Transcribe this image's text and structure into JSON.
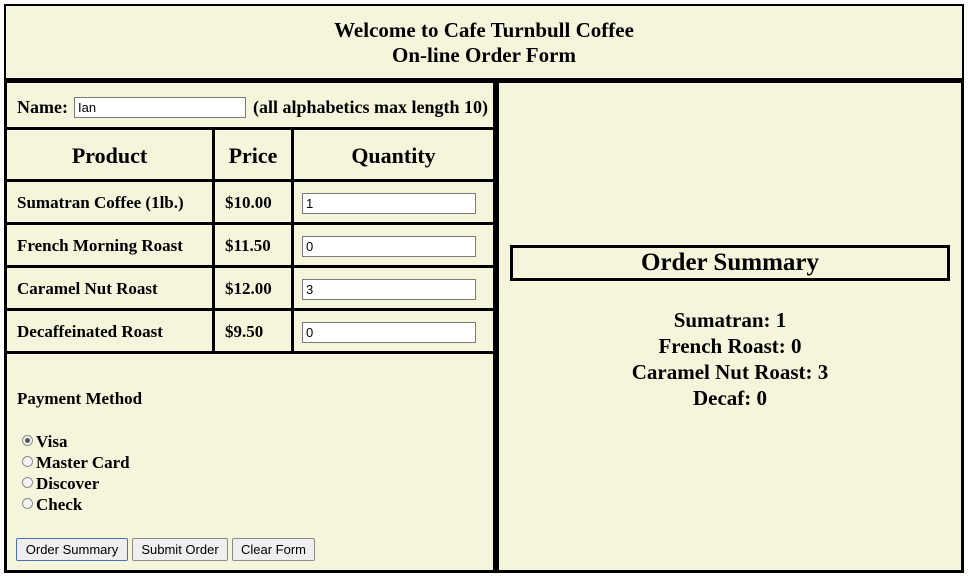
{
  "header": {
    "line1": "Welcome to Cafe Turnbull Coffee",
    "line2": "On-line Order Form"
  },
  "form": {
    "name_label": "Name:",
    "name_value": "Ian",
    "name_hint": "(all alphabetics max length 10)",
    "columns": [
      "Product",
      "Price",
      "Quantity"
    ],
    "products": [
      {
        "name": "Sumatran Coffee (1lb.)",
        "price": "$10.00",
        "qty": "1"
      },
      {
        "name": "French Morning Roast",
        "price": "$11.50",
        "qty": "0"
      },
      {
        "name": "Caramel Nut Roast",
        "price": "$12.00",
        "qty": "3"
      },
      {
        "name": "Decaffeinated Roast",
        "price": "$9.50",
        "qty": "0"
      }
    ],
    "payment_title": "Payment Method",
    "payment_options": [
      {
        "label": "Visa",
        "checked": true
      },
      {
        "label": "Master Card",
        "checked": false
      },
      {
        "label": "Discover",
        "checked": false
      },
      {
        "label": "Check",
        "checked": false
      }
    ],
    "buttons": {
      "summary": "Order Summary",
      "submit": "Submit Order",
      "clear": "Clear Form"
    }
  },
  "summary": {
    "title": "Order Summary",
    "lines": [
      "Sumatran: 1",
      "French Roast: 0",
      "Caramel Nut Roast: 3",
      "Decaf: 0"
    ]
  },
  "colors": {
    "panel_bg": "#f5f5dc",
    "border": "#000000"
  }
}
